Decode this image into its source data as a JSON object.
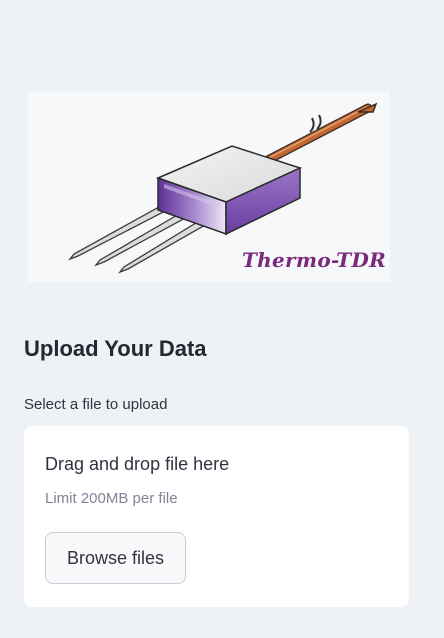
{
  "logo": {
    "text": "Thermo-TDR",
    "icon": "tdr-probe-icon",
    "colors": {
      "body_purple": "#6b3fa0",
      "wire_copper": "#c2672f",
      "text_purple": "#7a2a7c"
    }
  },
  "upload": {
    "title": "Upload Your Data",
    "label": "Select a file to upload",
    "dropzone": {
      "title": "Drag and drop file here",
      "limit": "Limit 200MB per file",
      "button_label": "Browse files"
    }
  }
}
